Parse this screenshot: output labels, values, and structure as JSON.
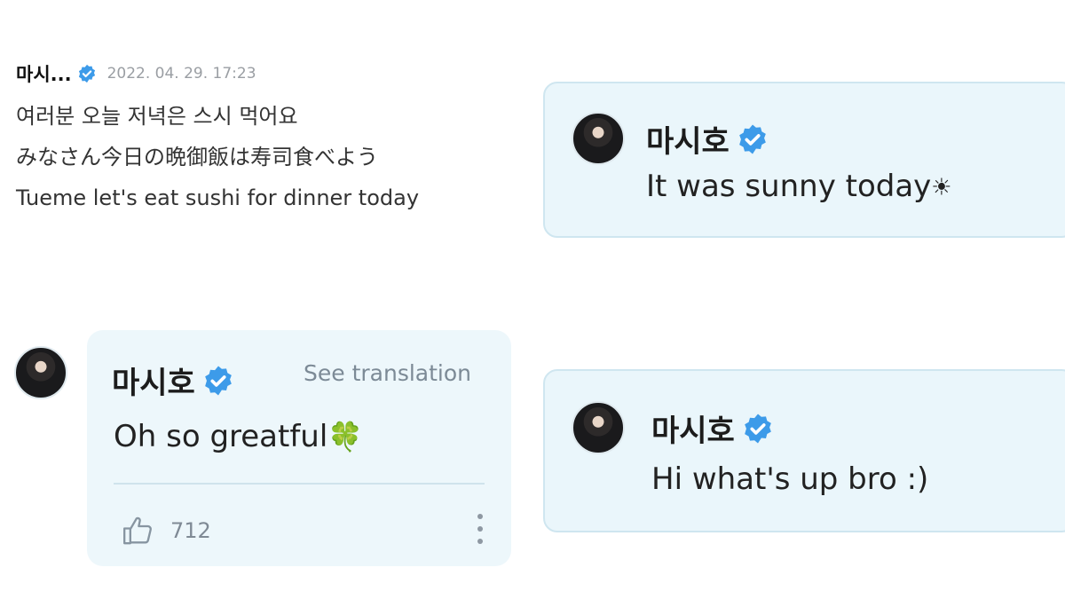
{
  "post_top_left": {
    "name": "마시...",
    "timestamp": "2022. 04. 29. 17:23",
    "lines": [
      "여러분 오늘 저녁은 스시 먹어요",
      "みなさん今日の晩御飯は寿司食べよう",
      "Tueme let's eat sushi for dinner today"
    ]
  },
  "card_sunny": {
    "name": "마시호",
    "text": "It was sunny today",
    "emoji": "☀"
  },
  "card_comment": {
    "name": "마시호",
    "see_translation": "See translation",
    "text": "Oh so greatful",
    "emoji": "🍀",
    "like_count": "712"
  },
  "card_hi": {
    "name": "마시호",
    "text": "Hi what's up bro :)"
  },
  "colors": {
    "verified_badge": "#3d9be9",
    "card_bg": "#eaf6fb",
    "card_border": "#cfe6f0"
  },
  "icons": [
    "verified-badge-icon",
    "thumbs-up-icon",
    "more-options-icon"
  ]
}
